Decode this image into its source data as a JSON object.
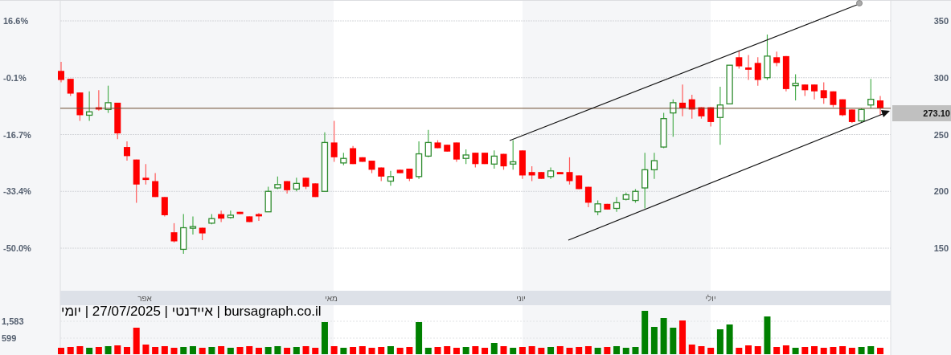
{
  "chart": {
    "left_axis_labels": [
      "16.6%",
      "-0.1%",
      "-16.7%",
      "-33.4%",
      "-50.0%"
    ],
    "right_axis_labels": [
      "350",
      "300",
      "250",
      "200",
      "150"
    ],
    "price_tag": "273.10",
    "month_labels": [
      "יולי",
      "יוני",
      "מאי",
      "אפר"
    ],
    "caption": "bursagraph.co.il | איידנטי | 27/07/2025 | יומי",
    "volume_axis_labels": [
      "1,583",
      "599"
    ],
    "chart_data": {
      "type": "candlestick",
      "ylim": [
        150,
        350
      ],
      "yticks": [
        150,
        200,
        250,
        300,
        350
      ],
      "grid": true,
      "ohlc": [
        [
          306,
          314,
          296,
          298
        ],
        [
          299,
          299,
          284,
          286
        ],
        [
          287,
          287,
          262,
          267
        ],
        [
          267,
          288,
          262,
          270
        ],
        [
          274,
          289,
          271,
          272
        ],
        [
          272,
          293,
          269,
          278
        ],
        [
          278,
          278,
          246,
          251
        ],
        [
          239,
          244,
          227,
          231
        ],
        [
          228,
          228,
          190,
          206
        ],
        [
          212,
          224,
          206,
          210
        ],
        [
          209,
          216,
          195,
          195
        ],
        [
          195,
          195,
          178,
          179
        ],
        [
          164,
          172,
          155,
          156
        ],
        [
          149,
          180,
          145,
          168
        ],
        [
          168,
          178,
          162,
          169
        ],
        [
          168,
          168,
          157,
          163
        ],
        [
          172,
          180,
          171,
          176
        ],
        [
          180,
          183,
          173,
          176
        ],
        [
          177,
          183,
          176,
          179
        ],
        [
          182,
          182,
          180,
          180
        ],
        [
          178,
          178,
          173,
          173
        ],
        [
          180,
          181,
          174,
          178
        ],
        [
          182,
          204,
          182,
          200
        ],
        [
          203,
          213,
          202,
          206
        ],
        [
          209,
          209,
          198,
          201
        ],
        [
          202,
          212,
          200,
          207
        ],
        [
          212,
          212,
          202,
          204
        ],
        [
          207,
          207,
          195,
          195
        ],
        [
          200,
          252,
          200,
          243
        ],
        [
          243,
          262,
          226,
          230
        ],
        [
          225,
          234,
          223,
          229
        ],
        [
          238,
          240,
          224,
          224
        ],
        [
          230,
          230,
          226,
          226
        ],
        [
          227,
          227,
          216,
          219
        ],
        [
          221,
          221,
          209,
          213
        ],
        [
          209,
          218,
          205,
          213
        ],
        [
          219,
          219,
          216,
          216
        ],
        [
          220,
          220,
          209,
          211
        ],
        [
          213,
          244,
          211,
          233
        ],
        [
          231,
          254,
          230,
          243
        ],
        [
          243,
          245,
          238,
          238
        ],
        [
          241,
          241,
          235,
          235
        ],
        [
          243,
          243,
          226,
          228
        ],
        [
          229,
          237,
          224,
          232
        ],
        [
          234,
          234,
          221,
          224
        ],
        [
          234,
          234,
          224,
          224
        ],
        [
          224,
          236,
          220,
          231
        ],
        [
          233,
          233,
          219,
          222
        ],
        [
          224,
          245,
          219,
          226
        ],
        [
          236,
          236,
          211,
          214
        ],
        [
          217,
          222,
          209,
          214
        ],
        [
          217,
          217,
          211,
          211
        ],
        [
          213,
          221,
          211,
          218
        ],
        [
          217,
          217,
          215,
          215
        ],
        [
          217,
          230,
          206,
          209
        ],
        [
          214,
          214,
          202,
          202
        ],
        [
          204,
          204,
          186,
          190
        ],
        [
          182,
          192,
          179,
          189
        ],
        [
          189,
          189,
          184,
          184
        ],
        [
          185,
          195,
          182,
          190
        ],
        [
          193,
          199,
          192,
          197
        ],
        [
          192,
          202,
          190,
          200
        ],
        [
          203,
          234,
          185,
          219
        ],
        [
          219,
          234,
          211,
          227
        ],
        [
          239,
          269,
          238,
          264
        ],
        [
          269,
          281,
          248,
          278
        ],
        [
          278,
          294,
          266,
          273
        ],
        [
          281,
          285,
          264,
          272
        ],
        [
          274,
          274,
          264,
          266
        ],
        [
          274,
          274,
          257,
          261
        ],
        [
          265,
          292,
          241,
          276
        ],
        [
          277,
          311,
          277,
          311
        ],
        [
          318,
          324,
          308,
          310
        ],
        [
          309,
          320,
          298,
          307
        ],
        [
          313,
          318,
          293,
          298
        ],
        [
          300,
          338,
          298,
          319
        ],
        [
          318,
          323,
          310,
          313
        ],
        [
          319,
          319,
          288,
          290
        ],
        [
          293,
          303,
          280,
          295
        ],
        [
          294,
          294,
          284,
          289
        ],
        [
          294,
          294,
          281,
          288
        ],
        [
          289,
          296,
          277,
          282
        ],
        [
          288,
          288,
          274,
          276
        ],
        [
          281,
          281,
          266,
          267
        ],
        [
          272,
          272,
          260,
          261
        ],
        [
          262,
          273,
          261,
          272
        ],
        [
          276,
          299,
          273,
          281
        ],
        [
          280,
          284,
          267,
          273.1
        ]
      ]
    }
  }
}
